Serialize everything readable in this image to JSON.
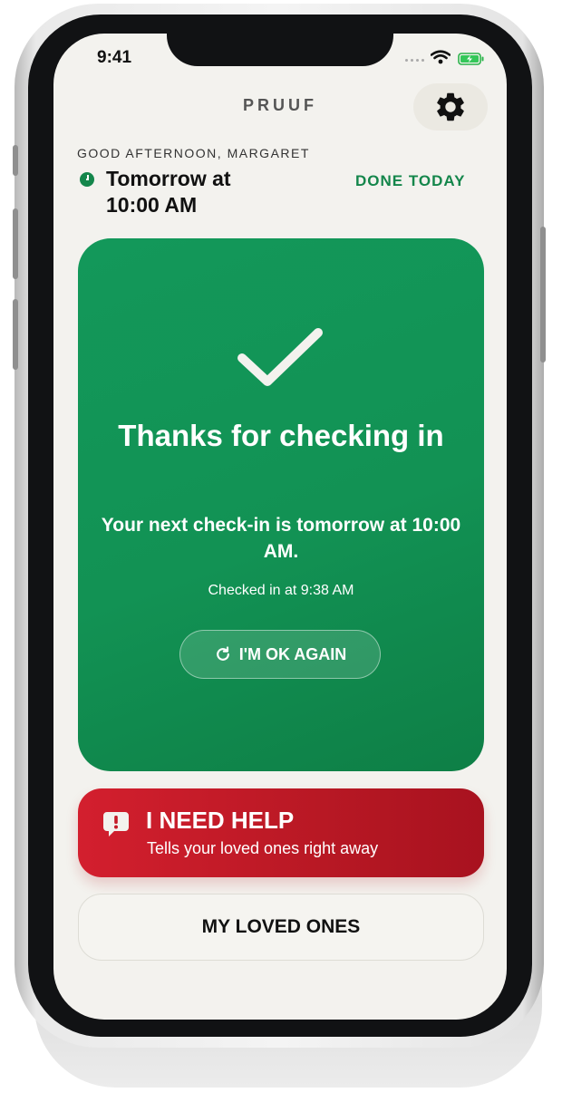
{
  "status_bar": {
    "time": "9:41"
  },
  "header": {
    "brand": "PRUUF",
    "settings_icon": "gear-icon"
  },
  "schedule": {
    "greeting": "GOOD AFTERNOON, MARGARET",
    "next_time": "Tomorrow at 10:00 AM",
    "status": "DONE TODAY"
  },
  "confirmation_card": {
    "icon": "checkmark-icon",
    "title": "Thanks for checking in",
    "next_checkin": "Your next check-in is tomorrow at 10:00 AM.",
    "checked_in": "Checked in at 9:38 AM",
    "ok_again_label": "I'M OK AGAIN",
    "ok_again_icon": "refresh-icon"
  },
  "help_button": {
    "label": "I NEED HELP",
    "sublabel": "Tells your loved ones right away",
    "icon": "alert-bubble-icon"
  },
  "loved_ones_button": {
    "label": "MY LOVED ONES"
  },
  "colors": {
    "accent_green": "#14864b",
    "card_green": "#129254",
    "help_red": "#c41b28",
    "background": "#f3f2ee"
  }
}
